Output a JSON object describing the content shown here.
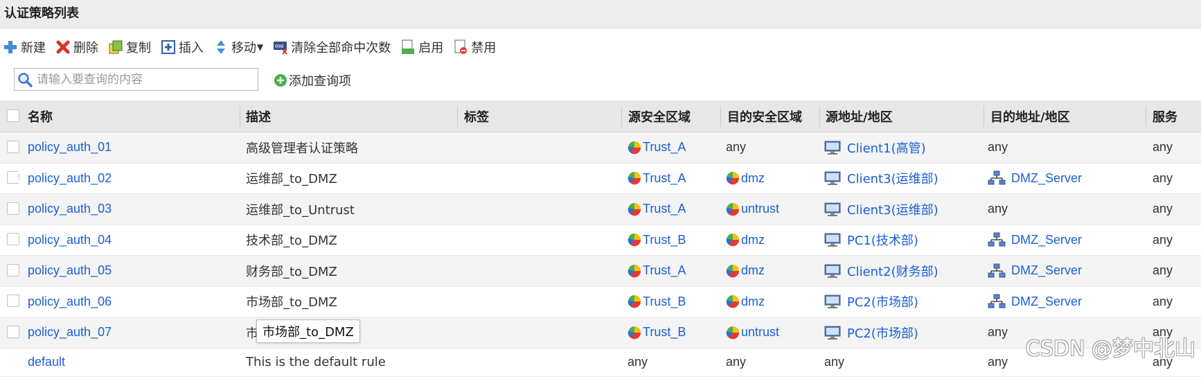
{
  "title": "认证策略列表",
  "toolbar": {
    "new": "新建",
    "delete": "删除",
    "copy": "复制",
    "insert": "插入",
    "move": "移动",
    "clear_hits": "清除全部命中次数",
    "enable": "启用",
    "disable": "禁用"
  },
  "search": {
    "placeholder": "请输入要查询的内容",
    "add_query": "添加查询项"
  },
  "columns": {
    "name": "名称",
    "desc": "描述",
    "tag": "标签",
    "src_zone": "源安全区域",
    "dst_zone": "目的安全区域",
    "src_addr": "源地址/地区",
    "dst_addr": "目的地址/地区",
    "service": "服务"
  },
  "rows": [
    {
      "name": "policy_auth_01",
      "desc": "高级管理者认证策略",
      "src_zone": "Trust_A",
      "dst_zone": "any",
      "src_addr": "Client1(高管)",
      "dst_addr": "any",
      "service": "any"
    },
    {
      "name": "policy_auth_02",
      "desc": "运维部_to_DMZ",
      "src_zone": "Trust_A",
      "dst_zone": "dmz",
      "src_addr": "Client3(运维部)",
      "dst_addr": "DMZ_Server",
      "service": "any"
    },
    {
      "name": "policy_auth_03",
      "desc": "运维部_to_Untrust",
      "src_zone": "Trust_A",
      "dst_zone": "untrust",
      "src_addr": "Client3(运维部)",
      "dst_addr": "any",
      "service": "any"
    },
    {
      "name": "policy_auth_04",
      "desc": "技术部_to_DMZ",
      "src_zone": "Trust_B",
      "dst_zone": "dmz",
      "src_addr": "PC1(技术部)",
      "dst_addr": "DMZ_Server",
      "service": "any"
    },
    {
      "name": "policy_auth_05",
      "desc": "财务部_to_DMZ",
      "src_zone": "Trust_A",
      "dst_zone": "dmz",
      "src_addr": "Client2(财务部)",
      "dst_addr": "DMZ_Server",
      "service": "any"
    },
    {
      "name": "policy_auth_06",
      "desc": "市场部_to_DMZ",
      "src_zone": "Trust_B",
      "dst_zone": "dmz",
      "src_addr": "PC2(市场部)",
      "dst_addr": "DMZ_Server",
      "service": "any"
    },
    {
      "name": "policy_auth_07",
      "desc": "市",
      "src_zone": "Trust_B",
      "dst_zone": "untrust",
      "src_addr": "PC2(市场部)",
      "dst_addr": "any",
      "service": "any"
    },
    {
      "name": "default",
      "desc": "This is the default rule",
      "src_zone": "any",
      "dst_zone": "any",
      "src_addr": "any",
      "dst_addr": "any",
      "service": "any"
    }
  ],
  "tooltip": "市场部_to_DMZ",
  "watermark": "CSDN @梦中北山",
  "colors": {
    "link": "#1a5fd6",
    "header_bg": "#e7e7e7",
    "title_bg": "#ececec"
  }
}
